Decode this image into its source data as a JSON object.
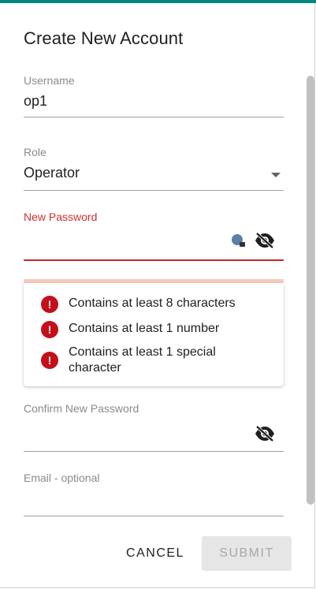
{
  "dialog": {
    "title": "Create New Account",
    "accent_color": "#00897b"
  },
  "fields": {
    "username": {
      "label": "Username",
      "value": "op1"
    },
    "role": {
      "label": "Role",
      "value": "Operator"
    },
    "new_password": {
      "label": "New Password",
      "value": "",
      "error_color": "#c62828",
      "icons": [
        "password-key-icon",
        "visibility-off-icon"
      ]
    },
    "confirm_password": {
      "label": "Confirm New Password",
      "value": "",
      "icons": [
        "visibility-off-icon"
      ]
    },
    "email": {
      "label": "Email - optional",
      "value": ""
    }
  },
  "requirements": [
    {
      "icon": "error-icon",
      "text": "Contains at least 8 characters"
    },
    {
      "icon": "error-icon",
      "text": "Contains at least 1 number"
    },
    {
      "icon": "error-icon",
      "text": "Contains at least 1 special character"
    }
  ],
  "actions": {
    "cancel": "CANCEL",
    "submit": "SUBMIT"
  },
  "error_icon_glyph": "!"
}
